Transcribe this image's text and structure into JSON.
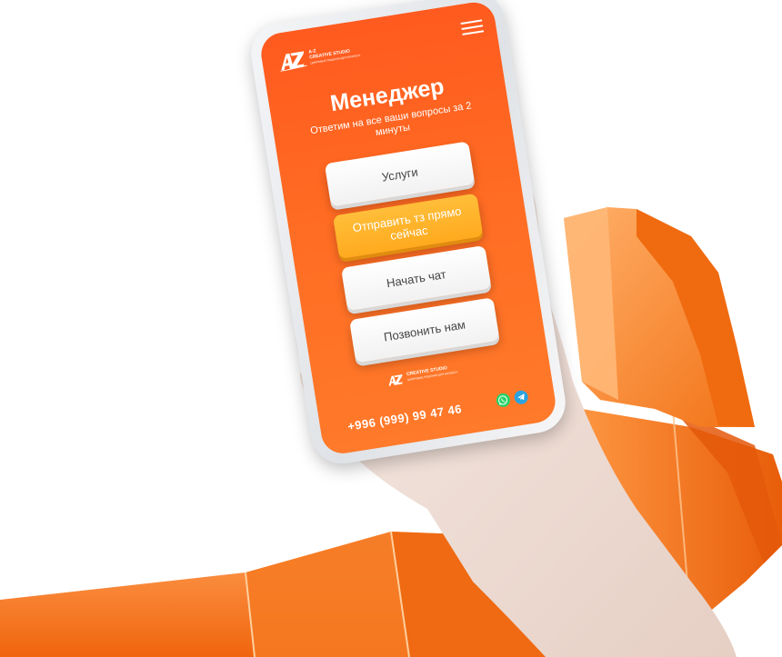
{
  "screen": {
    "logo": {
      "letters": "AZ",
      "line1": "A-Z",
      "line2": "CREATIVE STUDIO",
      "line3": "ЦИФРОВЫЕ РЕШЕНИЯ ДЛЯ БИЗНЕСА"
    },
    "title": "Менеджер",
    "subtitle": "Ответим на все ваши вопросы за 2 минуты",
    "buttons": [
      "Услуги",
      "Отправить тз прямо сейчас",
      "Начать чат",
      "Позвонить нам"
    ],
    "footer_logo": {
      "letters": "AZ",
      "line1": "CREATIVE STUDIO",
      "line2": "ЦИФРОВЫЕ РЕШЕНИЯ ДЛЯ БИЗНЕСА"
    },
    "phone": "+996 (999) 99 47 46",
    "icons": {
      "menu": "hamburger-icon",
      "whatsapp": "whatsapp-icon",
      "telegram": "telegram-icon"
    }
  },
  "colors": {
    "screen_top": "#ff5a1f",
    "screen_bottom": "#ff7a2a",
    "accent_button": "#ffaa1e",
    "ribbon": "#ff7a1a"
  }
}
